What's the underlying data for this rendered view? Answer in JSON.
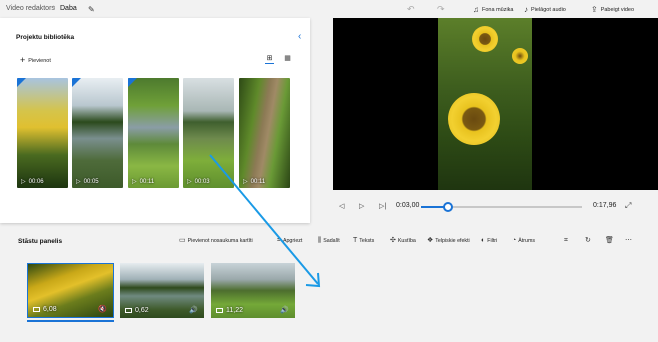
{
  "topbar": {
    "breadcrumb_parent": "Video redaktors",
    "breadcrumb_current": "Daba",
    "edit_icon": "pencil-icon",
    "undo_icon": "undo-icon",
    "redo_icon": "redo-icon",
    "bg_music_label": "Fona mūzika",
    "custom_audio_label": "Pielāgot audio",
    "finish_video_label": "Pabeigt video"
  },
  "library": {
    "title": "Projektu bibliotēka",
    "add_label": "Pievienot",
    "items": [
      {
        "duration": "00:06",
        "in_use": true
      },
      {
        "duration": "00:05",
        "in_use": true
      },
      {
        "duration": "00:11",
        "in_use": true
      },
      {
        "duration": "00:03",
        "in_use": false
      },
      {
        "duration": "00:11",
        "in_use": false
      }
    ]
  },
  "preview": {
    "current_time": "0:03,00",
    "total_time": "0:17,96",
    "progress": 0.17
  },
  "storyboard": {
    "title": "Stāstu panelis",
    "tools": {
      "title_card": "Pievienot nosaukuma kartīti",
      "trim": "Apgriezt",
      "split": "Sadalīt",
      "text": "Teksts",
      "motion": "Kustība",
      "effects3d": "Telpiskie efekti",
      "filters": "Filtri",
      "speed": "Ātrums"
    },
    "clips": [
      {
        "duration": "6,08",
        "audio": "muted"
      },
      {
        "duration": "0,62",
        "audio": "on"
      },
      {
        "duration": "11,22",
        "audio": "on"
      }
    ]
  },
  "colors": {
    "accent": "#1a73d6",
    "panel_bg": "#ffffff",
    "app_bg": "#f2f2f2"
  }
}
